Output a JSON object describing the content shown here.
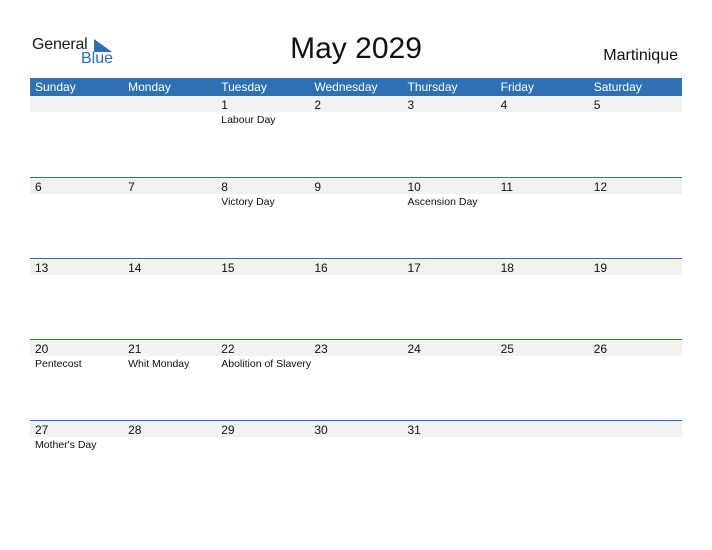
{
  "logo": {
    "general": "General",
    "blue": "Blue",
    "icon": "triangle-flag-icon",
    "accent": "#2b6fb6"
  },
  "header": {
    "title": "May 2029",
    "country": "Martinique"
  },
  "colors": {
    "header_bg": "#2e71b3",
    "header_text": "#ffffff",
    "number_bar": "#f2f2f2"
  },
  "weekdays": [
    "Sunday",
    "Monday",
    "Tuesday",
    "Wednesday",
    "Thursday",
    "Friday",
    "Saturday"
  ],
  "weeks": [
    [
      {
        "day": "",
        "holiday": ""
      },
      {
        "day": "",
        "holiday": ""
      },
      {
        "day": "1",
        "holiday": "Labour Day"
      },
      {
        "day": "2",
        "holiday": ""
      },
      {
        "day": "3",
        "holiday": ""
      },
      {
        "day": "4",
        "holiday": ""
      },
      {
        "day": "5",
        "holiday": ""
      }
    ],
    [
      {
        "day": "6",
        "holiday": ""
      },
      {
        "day": "7",
        "holiday": ""
      },
      {
        "day": "8",
        "holiday": "Victory Day"
      },
      {
        "day": "9",
        "holiday": ""
      },
      {
        "day": "10",
        "holiday": "Ascension Day"
      },
      {
        "day": "11",
        "holiday": ""
      },
      {
        "day": "12",
        "holiday": ""
      }
    ],
    [
      {
        "day": "13",
        "holiday": ""
      },
      {
        "day": "14",
        "holiday": ""
      },
      {
        "day": "15",
        "holiday": ""
      },
      {
        "day": "16",
        "holiday": ""
      },
      {
        "day": "17",
        "holiday": ""
      },
      {
        "day": "18",
        "holiday": ""
      },
      {
        "day": "19",
        "holiday": ""
      }
    ],
    [
      {
        "day": "20",
        "holiday": "Pentecost"
      },
      {
        "day": "21",
        "holiday": "Whit Monday"
      },
      {
        "day": "22",
        "holiday": "Abolition of Slavery"
      },
      {
        "day": "23",
        "holiday": ""
      },
      {
        "day": "24",
        "holiday": ""
      },
      {
        "day": "25",
        "holiday": ""
      },
      {
        "day": "26",
        "holiday": ""
      }
    ],
    [
      {
        "day": "27",
        "holiday": "Mother's Day"
      },
      {
        "day": "28",
        "holiday": ""
      },
      {
        "day": "29",
        "holiday": ""
      },
      {
        "day": "30",
        "holiday": ""
      },
      {
        "day": "31",
        "holiday": ""
      },
      {
        "day": "",
        "holiday": ""
      },
      {
        "day": "",
        "holiday": ""
      }
    ]
  ]
}
